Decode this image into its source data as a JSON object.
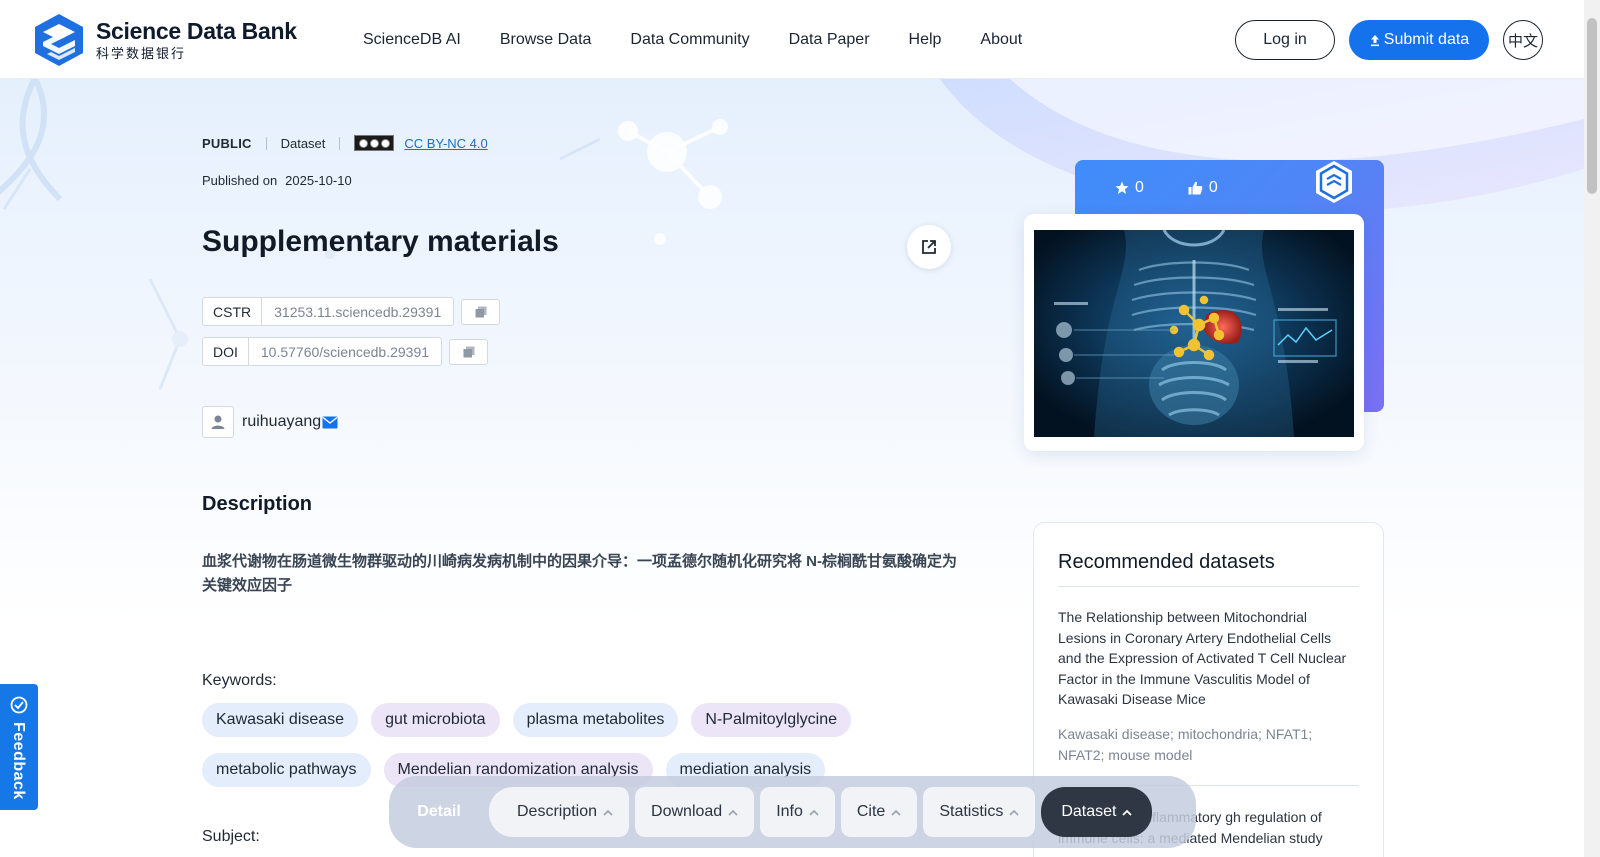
{
  "header": {
    "logo_en": "Science Data Bank",
    "logo_cn": "科学数据银行",
    "nav": [
      "ScienceDB AI",
      "Browse Data",
      "Data Community",
      "Data Paper",
      "Help",
      "About"
    ],
    "login": "Log in",
    "submit": "Submit data",
    "lang": "中文"
  },
  "dataset": {
    "access": "PUBLIC",
    "type": "Dataset",
    "license": "CC BY-NC 4.0",
    "published_label": "Published on",
    "published_date": "2025-10-10",
    "title": "Supplementary materials",
    "cstr_label": "CSTR",
    "cstr": "31253.11.sciencedb.29391",
    "doi_label": "DOI",
    "doi": "10.57760/sciencedb.29391",
    "author": "ruihuayang",
    "stars": "0",
    "likes": "0"
  },
  "description": {
    "heading": "Description",
    "text": "血浆代谢物在肠道微生物群驱动的川崎病发病机制中的因果介导：一项孟德尔随机化研究将 N-棕榈酰甘氨酸确定为关键效应因子",
    "keywords_label": "Keywords:",
    "keywords_row1": [
      "Kawasaki disease",
      "gut microbiota",
      "plasma metabolites",
      "N-Palmitoylglycine"
    ],
    "keywords_row2": [
      "metabolic pathways",
      "Mendelian randomization analysis",
      "mediation analysis"
    ],
    "subject_label": "Subject:"
  },
  "recommended": {
    "heading": "Recommended datasets",
    "item1_title": "The Relationship between Mitochondrial Lesions in Coronary Artery Endothelial Cells and the Expression of Activated T Cell Nuclear Factor in the Immune Vasculitis Model of Kawasaki Disease Mice",
    "item1_keywords": "Kawasaki disease; mitochondria; NFAT1; NFAT2; mouse model",
    "item2_title": "ce the risk of inflammatory gh regulation of immune cells: a mediated Mendelian study"
  },
  "feedback": "Feedback",
  "tabs": {
    "detail": "Detail",
    "items": [
      "Description",
      "Download",
      "Info",
      "Cite",
      "Statistics"
    ],
    "active": "Dataset"
  },
  "colors": {
    "primary": "#1472ec",
    "tab_active": "#2f3744"
  }
}
